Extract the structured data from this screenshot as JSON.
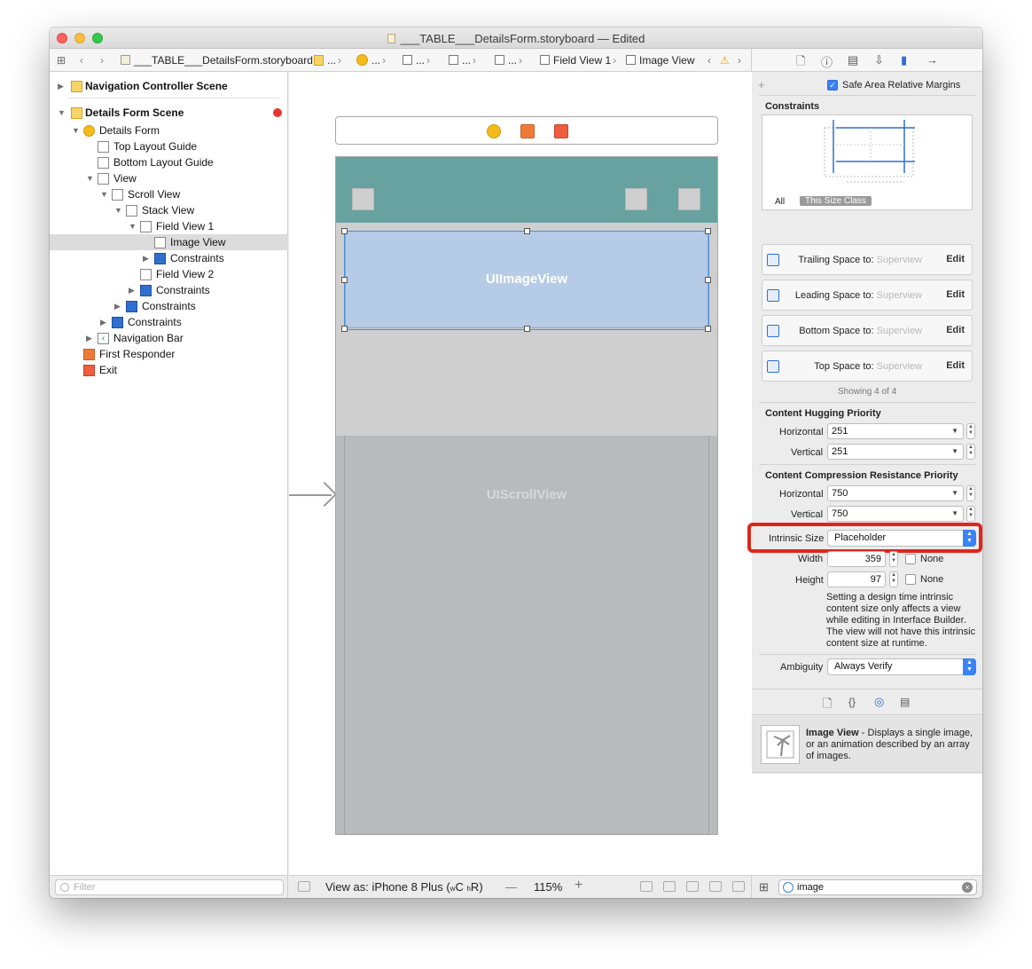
{
  "window": {
    "title": "___TABLE___DetailsForm.storyboard — Edited"
  },
  "jumpbar": {
    "file": "___TABLE___DetailsForm.storyboard",
    "ellipsis": "...",
    "field_view": "Field View 1",
    "image_view": "Image View"
  },
  "outline": {
    "items": [
      {
        "label": "Navigation Controller Scene"
      },
      {
        "label": "Details Form Scene"
      },
      {
        "label": "Details Form"
      },
      {
        "label": "Top Layout Guide"
      },
      {
        "label": "Bottom Layout Guide"
      },
      {
        "label": "View"
      },
      {
        "label": "Scroll View"
      },
      {
        "label": "Stack View"
      },
      {
        "label": "Field View 1"
      },
      {
        "label": "Image View"
      },
      {
        "label": "Constraints"
      },
      {
        "label": "Field View 2"
      },
      {
        "label": "Constraints"
      },
      {
        "label": "Constraints"
      },
      {
        "label": "Constraints"
      },
      {
        "label": "Navigation Bar"
      },
      {
        "label": "First Responder"
      },
      {
        "label": "Exit"
      }
    ],
    "filter_placeholder": "Filter"
  },
  "canvas": {
    "image_view_label": "UIImageView",
    "scroll_view_label": "UIScrollView",
    "navbar_color": "#67a1a0",
    "image_view_color": "#b6cbe5"
  },
  "bottom_bar": {
    "view_as": "View as: iPhone 8 Plus (",
    "size_w": "w",
    "size_c": "C",
    "size_h": "h",
    "size_r": "R",
    "close_paren": ")",
    "minus": "—",
    "zoom": "115%",
    "plus": "+"
  },
  "inspector": {
    "safe_area_label": "Safe Area Relative Margins",
    "safe_area_checked": true,
    "constraints_title": "Constraints",
    "size_all": "All",
    "size_this": "This Size Class",
    "constraints": [
      {
        "label": "Trailing Space to:",
        "target": "Superview",
        "edit": "Edit"
      },
      {
        "label": "Leading Space to:",
        "target": "Superview",
        "edit": "Edit"
      },
      {
        "label": "Bottom Space to:",
        "target": "Superview",
        "edit": "Edit"
      },
      {
        "label": "Top Space to:",
        "target": "Superview",
        "edit": "Edit"
      }
    ],
    "showing": "Showing 4 of 4",
    "hugging_title": "Content Hugging Priority",
    "horizontal": "Horizontal",
    "vertical": "Vertical",
    "hugging_h": "251",
    "hugging_v": "251",
    "compression_title": "Content Compression Resistance Priority",
    "compression_h": "750",
    "compression_v": "750",
    "intrinsic_label": "Intrinsic Size",
    "intrinsic_value": "Placeholder",
    "width_label": "Width",
    "width_value": "359",
    "height_label": "Height",
    "height_value": "97",
    "none_label": "None",
    "help_text": "Setting a design time intrinsic content size only affects a view while editing in Interface Builder. The view will not have this intrinsic content size at runtime.",
    "ambiguity_label": "Ambiguity",
    "ambiguity_value": "Always Verify",
    "library_title": "Image View",
    "library_desc": " - Displays a single image, or an animation described by an array of images.",
    "search_value": "image",
    "accent": "#3b82f6",
    "highlight": "#e0251b"
  }
}
